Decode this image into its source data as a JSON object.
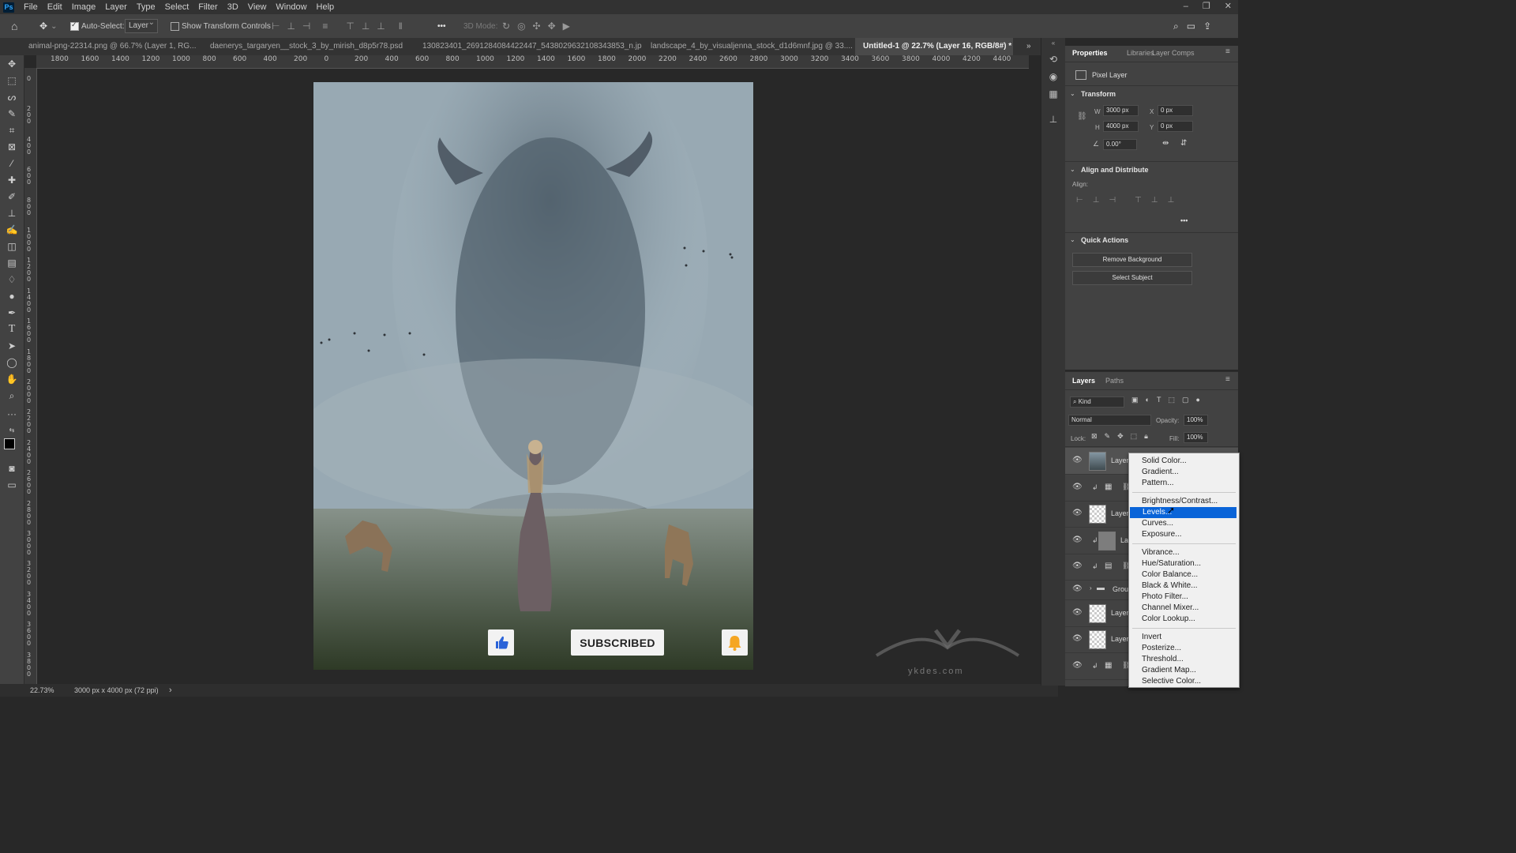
{
  "menubar": {
    "logo": "Ps",
    "items": [
      "File",
      "Edit",
      "Image",
      "Layer",
      "Type",
      "Select",
      "Filter",
      "3D",
      "View",
      "Window",
      "Help"
    ]
  },
  "options_bar": {
    "auto_select_label": "Auto-Select:",
    "auto_select_value": "Layer",
    "show_transform_label": "Show Transform Controls",
    "mode_3d_label": "3D Mode:",
    "more_label": "•••"
  },
  "tabs": [
    {
      "label": "animal-png-22314.png @ 66.7% (Layer 1, RG..."
    },
    {
      "label": "daenerys_targaryen__stock_3_by_mirish_d8p5r78.psd"
    },
    {
      "label": "130823401_2691284084422447_5438029632108343853_n.jpg"
    },
    {
      "label": "landscape_4_by_visualjenna_stock_d1d6mnf.jpg @ 33...."
    },
    {
      "label": "Untitled-1 @ 22.7% (Layer 16, RGB/8#) *"
    }
  ],
  "ruler_top": [
    "1800",
    "1600",
    "1400",
    "1200",
    "1000",
    "800",
    "600",
    "400",
    "200",
    "0",
    "200",
    "400",
    "600",
    "800",
    "1000",
    "1200",
    "1400",
    "1600",
    "1800",
    "2000",
    "2200",
    "2400",
    "2600",
    "2800",
    "3000",
    "3200",
    "3400",
    "3600",
    "3800",
    "4000",
    "4200",
    "4400"
  ],
  "ruler_left": [
    "0",
    "2 0 0",
    "4 0 0",
    "6 0 0",
    "8 0 0",
    "1 0 0 0",
    "1 2 0 0",
    "1 4 0 0",
    "1 6 0 0",
    "1 8 0 0",
    "2 0 0 0",
    "2 2 0 0",
    "2 4 0 0",
    "2 6 0 0",
    "2 8 0 0",
    "3 0 0 0",
    "3 2 0 0",
    "3 4 0 0",
    "3 6 0 0",
    "3 8 0 0"
  ],
  "canvas": {
    "subscribed_label": "SUBSCRIBED",
    "like_icon": "thumbs-up-icon",
    "bell_icon": "bell-icon",
    "watermark": "ykdes.com"
  },
  "status": {
    "zoom": "22.73%",
    "doc_info": "3000 px x 4000 px (72 ppi)",
    "arrow": "›"
  },
  "properties": {
    "tabs": [
      "Properties",
      "Libraries",
      "Layer Comps"
    ],
    "layer_type": "Pixel Layer",
    "transform_title": "Transform",
    "w_label": "W",
    "w_value": "3000 px",
    "h_label": "H",
    "h_value": "4000 px",
    "x_label": "X",
    "x_value": "0 px",
    "y_label": "Y",
    "y_value": "0 px",
    "angle_value": "0.00°",
    "align_title": "Align and Distribute",
    "align_label": "Align:",
    "more": "•••",
    "quick_title": "Quick Actions",
    "remove_bg": "Remove Background",
    "select_subject": "Select Subject"
  },
  "layers": {
    "tabs": [
      "Layers",
      "Paths"
    ],
    "kind_label": "Kind",
    "blend_mode": "Normal",
    "opacity_label": "Opacity:",
    "opacity_value": "100%",
    "lock_label": "Lock:",
    "fill_label": "Fill:",
    "fill_value": "100%",
    "rows": [
      {
        "name": "Layer"
      },
      {
        "name": ""
      },
      {
        "name": "Layer"
      },
      {
        "name": "La"
      },
      {
        "name": ""
      },
      {
        "name": "Grou"
      },
      {
        "name": "Layer"
      },
      {
        "name": "Layer"
      },
      {
        "name": ""
      }
    ]
  },
  "adjustment_menu": {
    "group1": [
      "Solid Color...",
      "Gradient...",
      "Pattern..."
    ],
    "group2": [
      "Brightness/Contrast...",
      "Levels...",
      "Curves...",
      "Exposure..."
    ],
    "group3": [
      "Vibrance...",
      "Hue/Saturation...",
      "Color Balance...",
      "Black & White...",
      "Photo Filter...",
      "Channel Mixer...",
      "Color Lookup..."
    ],
    "group4": [
      "Invert",
      "Posterize...",
      "Threshold...",
      "Gradient Map...",
      "Selective Color..."
    ],
    "highlighted": "Levels..."
  },
  "colors": {
    "menu_highlight": "#0a64d8",
    "app_bg": "#282828",
    "panel_bg": "#424242"
  }
}
